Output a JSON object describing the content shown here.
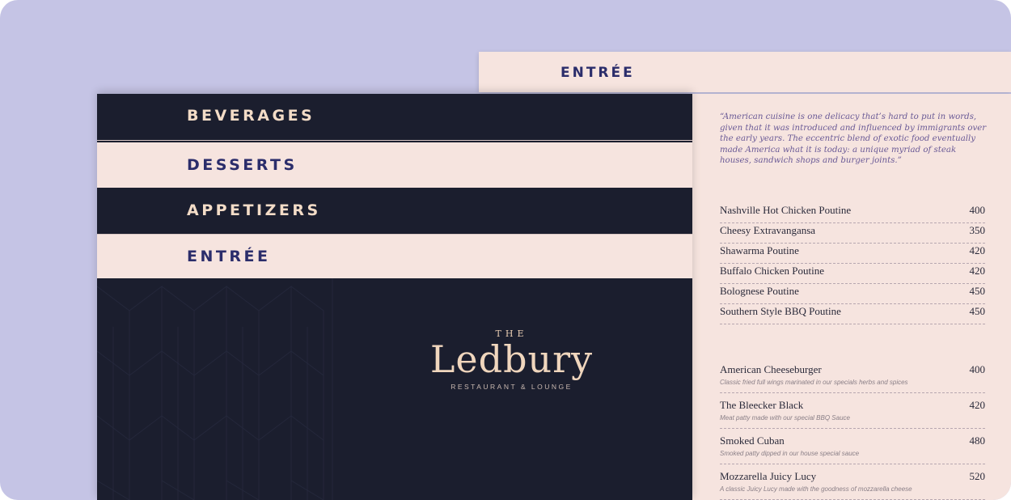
{
  "tabs": {
    "right_tab": "ENTRÉE",
    "categories": [
      {
        "label": "BEVERAGES",
        "style": "dark"
      },
      {
        "label": "DESSERTS",
        "style": "light"
      },
      {
        "label": "APPETIZERS",
        "style": "dark"
      },
      {
        "label": "ENTRÉE",
        "style": "light"
      }
    ]
  },
  "brand": {
    "the": "THE",
    "name": "Ledbury",
    "subtitle": "RESTAURANT & LOUNGE"
  },
  "quote": "“American cuisine is one delicacy that’s hard to put in words, given that it was introduced and influenced by immigrants over the early years. The eccentric blend of exotic food eventually made America what it is today: a unique myriad of steak houses, sandwich shops and burger joints.”",
  "poutine_items": [
    {
      "name": "Nashville Hot Chicken Poutine",
      "price": "400"
    },
    {
      "name": "Cheesy Extravangansa",
      "price": "350"
    },
    {
      "name": "Shawarma Poutine",
      "price": "420"
    },
    {
      "name": "Buffalo Chicken Poutine",
      "price": "420"
    },
    {
      "name": "Bolognese Poutine",
      "price": "450"
    },
    {
      "name": "Southern Style BBQ Poutine",
      "price": "450"
    }
  ],
  "burger_items": [
    {
      "name": "American Cheeseburger",
      "price": "400",
      "desc": "Classic fried full wings marinated in our specials herbs and spices"
    },
    {
      "name": "The Bleecker Black",
      "price": "420",
      "desc": "Meat patty made with our special BBQ Sauce"
    },
    {
      "name": "Smoked Cuban",
      "price": "480",
      "desc": "Smoked patty dipped in our house special sauce"
    },
    {
      "name": "Mozzarella Juicy Lucy",
      "price": "520",
      "desc": "A classic Juicy Lucy made with the goodness of mozzarella cheese"
    }
  ],
  "colors": {
    "background": "#c5c4e5",
    "navy": "#1b1e2e",
    "cream": "#f6e4df",
    "accent_text": "#2b2d6b",
    "gold": "#f0d6bd"
  }
}
